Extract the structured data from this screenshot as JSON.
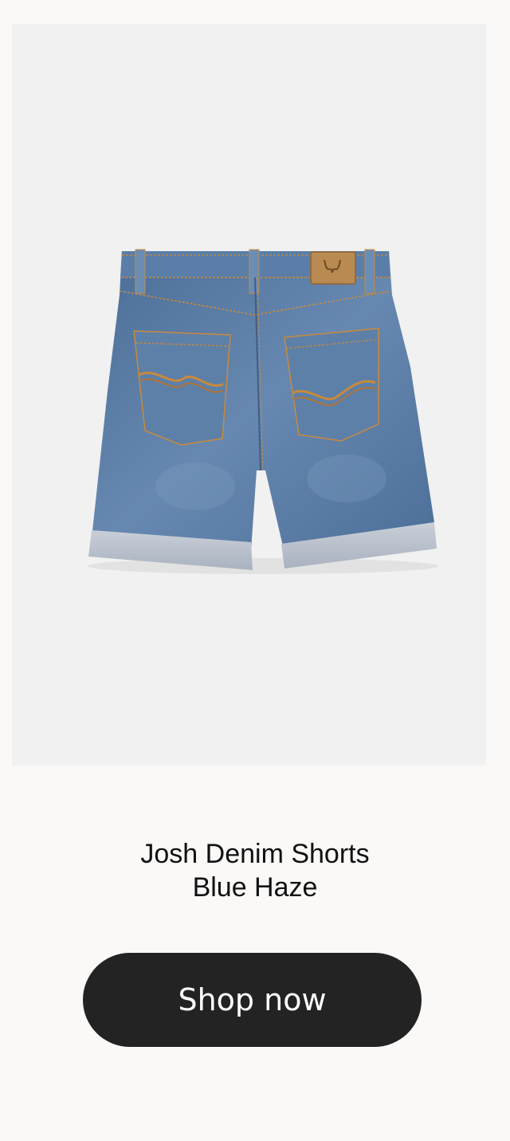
{
  "product": {
    "name_line1": "Josh Denim Shorts",
    "name_line2": "Blue Haze",
    "image_alt": "Josh Denim Shorts Blue Haze, back view"
  },
  "cta": {
    "label": "Shop now"
  },
  "colors": {
    "page_background": "#faf9f7",
    "image_background": "#f1f1f1",
    "button_background": "#232323",
    "button_text": "#ffffff",
    "denim": "#5577a0",
    "stitching": "#c98a3c"
  }
}
